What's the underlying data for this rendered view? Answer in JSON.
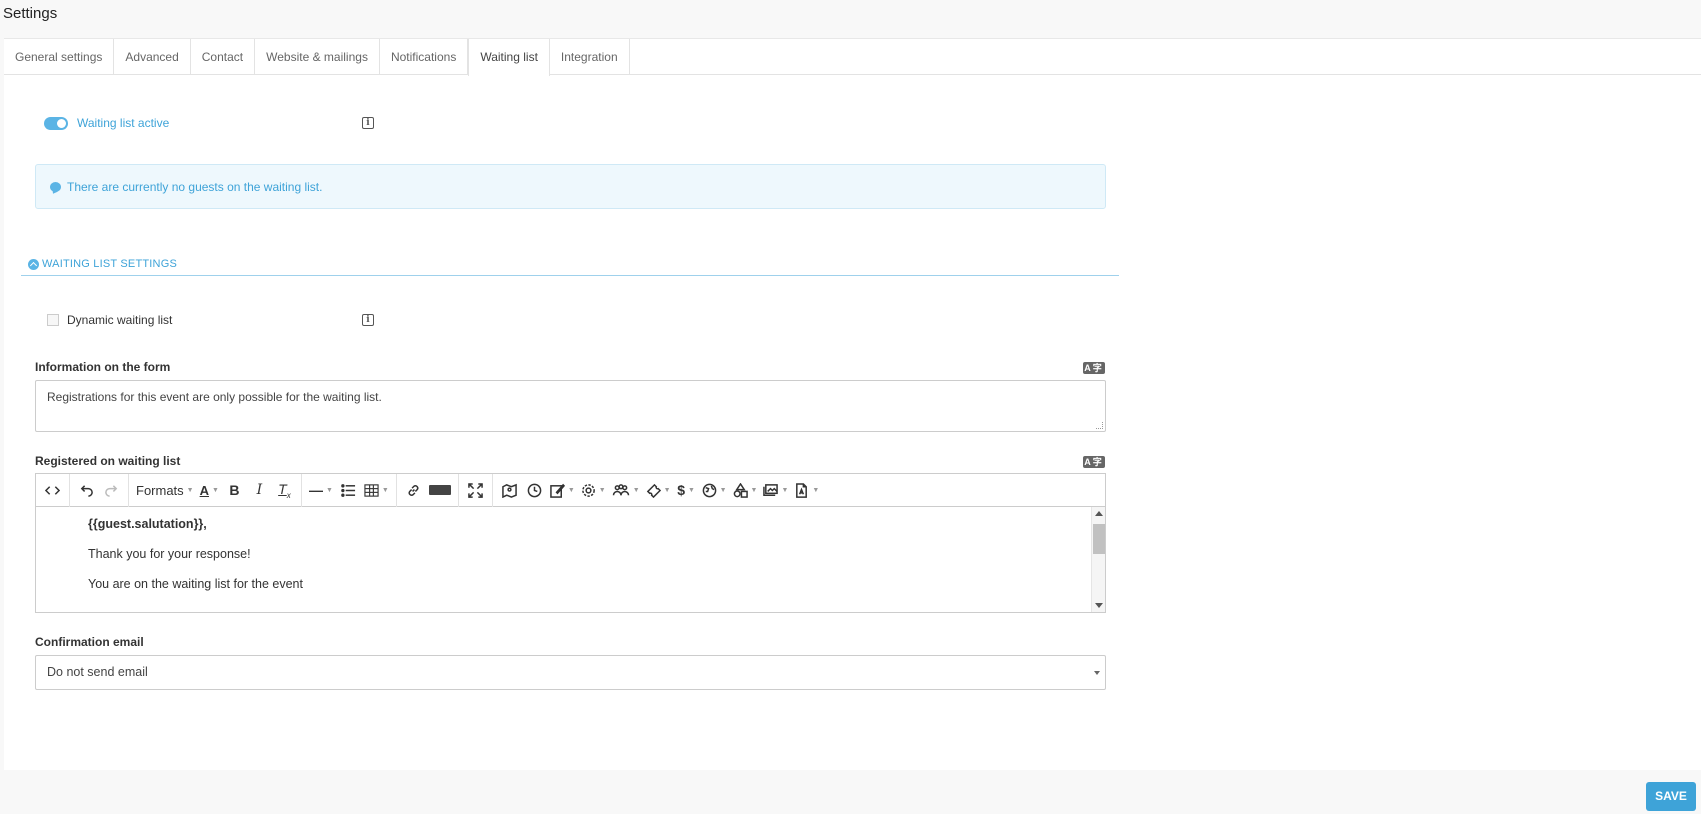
{
  "page": {
    "title": "Settings"
  },
  "tabs": [
    {
      "label": "General settings"
    },
    {
      "label": "Advanced"
    },
    {
      "label": "Contact"
    },
    {
      "label": "Website & mailings"
    },
    {
      "label": "Notifications"
    },
    {
      "label": "Waiting list",
      "active": true
    },
    {
      "label": "Integration"
    }
  ],
  "waiting_list": {
    "toggle_label": "Waiting list active",
    "toggle_on": true,
    "info_message": "There are currently no guests on the waiting list.",
    "section_title": "WAITING LIST SETTINGS",
    "dynamic_label": "Dynamic waiting list",
    "dynamic_checked": false
  },
  "form_info": {
    "label": "Information on the form",
    "value": "Registrations for this event are only possible for the waiting list."
  },
  "registered": {
    "label": "Registered on waiting list",
    "toolbar": {
      "formats_label": "Formats"
    },
    "content": [
      "{{guest.salutation}},",
      "Thank you for your response!",
      "You are on the waiting list for the event"
    ]
  },
  "confirmation": {
    "label": "Confirmation email",
    "selected": "Do not send email"
  },
  "footer": {
    "save_label": "SAVE"
  },
  "colors": {
    "accent": "#3ea3d8",
    "toggle": "#5bb4e5",
    "alert_bg": "#eef8fd"
  }
}
